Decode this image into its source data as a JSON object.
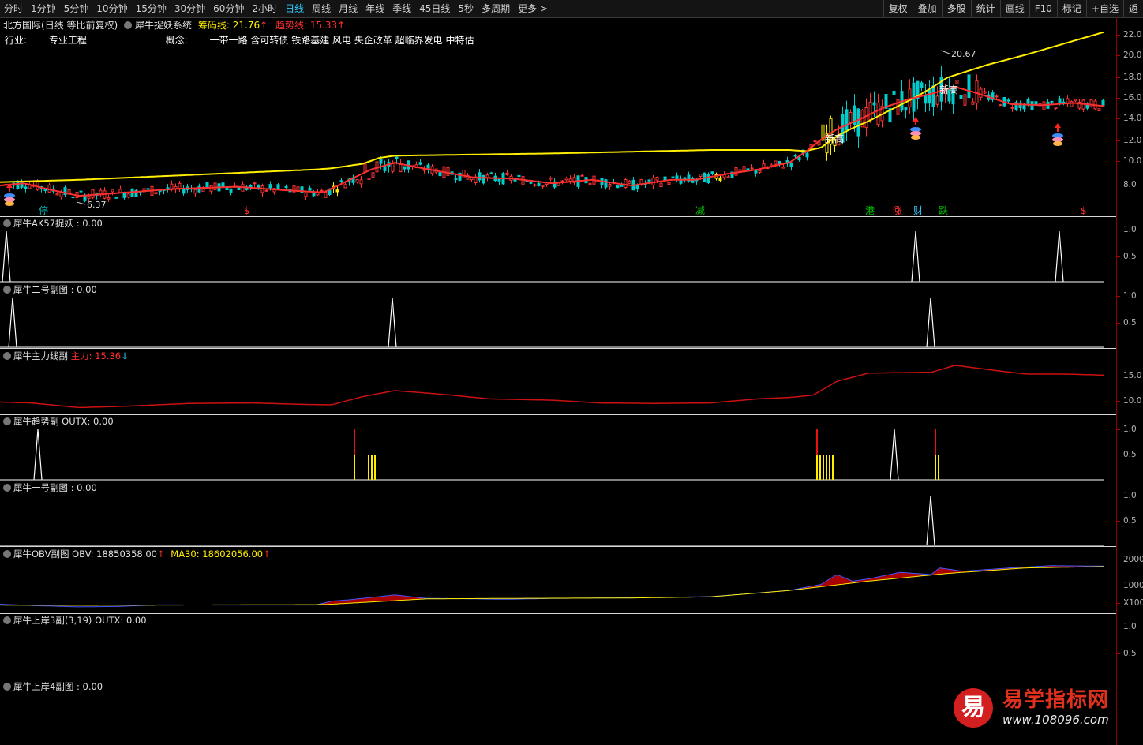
{
  "toolbar": {
    "periods": [
      "分时",
      "1分钟",
      "5分钟",
      "10分钟",
      "15分钟",
      "30分钟",
      "60分钟",
      "2小时",
      "日线",
      "周线",
      "月线",
      "年线",
      "季线",
      "45日线",
      "5秒",
      "多周期",
      "更多 >"
    ],
    "active_index": 8,
    "tools": [
      "复权",
      "叠加",
      "多股",
      "统计",
      "画线",
      "F10",
      "标记",
      "+自选",
      "返"
    ]
  },
  "stock": {
    "name": "北方国际",
    "mode": "(日线 等比前复权)",
    "system": "犀牛捉妖系统",
    "chip_label": "筹码线: 21.76",
    "trend_label": "趋势线: 15.33",
    "up_arrow": "↑",
    "down_arrow": "↓"
  },
  "meta": {
    "industry_label": "行业:",
    "industry": "专业工程",
    "concept_label": "概念:",
    "concepts": "一带一路 含可转债 铁路基建 风电 央企改革 超临界发电 中特估"
  },
  "main_chart": {
    "annotations": {
      "low": "6.37",
      "high": "20.67",
      "new_high": "新高"
    },
    "event_labels": [
      "停",
      "$",
      "减",
      "港",
      "涨",
      "财",
      "跌",
      "$"
    ],
    "yticks": [
      "22.0",
      "20.0",
      "18.0",
      "16.0",
      "14.0",
      "12.0",
      "10.0",
      "8.0"
    ]
  },
  "panels": [
    {
      "title": "犀牛AK57捉妖",
      "value": ": 0.00",
      "yticks": [
        "1.0",
        "0.5"
      ]
    },
    {
      "title": "犀牛二号副图",
      "value": ": 0.00",
      "yticks": [
        "1.0",
        "0.5"
      ]
    },
    {
      "title": "犀牛主力线副",
      "value_label": "主力: 15.36",
      "yticks": [
        "15.0",
        "10.0"
      ]
    },
    {
      "title": "犀牛趋势副",
      "value": "OUTX: 0.00",
      "yticks": [
        "1.0",
        "0.5"
      ]
    },
    {
      "title": "犀牛一号副图",
      "value": ": 0.00",
      "yticks": [
        "1.0",
        "0.5"
      ]
    },
    {
      "title": "犀牛OBV副图",
      "obv": "OBV: 18850358.00",
      "ma30": "MA30: 18602056.00",
      "yticks": [
        "2000",
        "1000",
        "X1000"
      ]
    },
    {
      "title": "犀牛上岸3副(3,19)",
      "value": "OUTX: 0.00",
      "yticks": [
        "1.0",
        "0.5"
      ]
    },
    {
      "title": "犀牛上岸4副图",
      "value": ": 0.00",
      "yticks": []
    }
  ],
  "watermark": {
    "logo": "易",
    "title": "易学指标网",
    "url": "www.108096.com"
  },
  "colors": {
    "trend_line": "#ff3030",
    "chip_line": "#ffee00",
    "main_line": "#cc1111",
    "obv_fill": "#aa0000",
    "up": "#ff3333",
    "down": "#00cccc",
    "yellow": "#ffee00",
    "teal": "#0bb"
  },
  "chart_data": [
    {
      "type": "line",
      "title": "",
      "y_range": [
        6.0,
        22.5
      ],
      "series": [
        {
          "name": "筹码线",
          "x": [
            0,
            100,
            200,
            300,
            400,
            420,
            440,
            460,
            480,
            500,
            600,
            700,
            800,
            900,
            1000,
            1020,
            1040,
            1060,
            1080,
            1100,
            1120,
            1140,
            1160,
            1180,
            1200,
            1250,
            1300,
            1350,
            1398
          ],
          "values": [
            8.7,
            8.9,
            9.2,
            9.5,
            9.8,
            9.9,
            10.1,
            10.3,
            10.8,
            11.0,
            11.1,
            11.2,
            11.35,
            11.5,
            11.5,
            11.4,
            11.7,
            12.7,
            13.4,
            14.0,
            14.7,
            15.4,
            16.1,
            16.9,
            17.8,
            18.9,
            19.8,
            20.8,
            21.76
          ]
        },
        {
          "name": "趋势线",
          "x": [
            0,
            30,
            60,
            100,
            160,
            220,
            300,
            360,
            410,
            440,
            470,
            500,
            520,
            560,
            600,
            650,
            700,
            750,
            800,
            850,
            880,
            920,
            960,
            1000,
            1020,
            1040,
            1060,
            1090,
            1120,
            1150,
            1180,
            1210,
            1240,
            1280,
            1320,
            1360,
            1398
          ],
          "values": [
            8.4,
            8.6,
            8.1,
            7.5,
            7.8,
            8.1,
            8.3,
            8.0,
            7.8,
            8.8,
            9.8,
            10.4,
            10.1,
            9.6,
            9.1,
            9.0,
            8.6,
            8.9,
            8.4,
            8.9,
            8.9,
            9.4,
            9.8,
            10.4,
            11.3,
            12.4,
            13.3,
            14.2,
            15.2,
            15.9,
            16.4,
            17.0,
            16.4,
            15.5,
            15.4,
            15.6,
            15.33
          ]
        }
      ]
    },
    {
      "type": "line",
      "title": "",
      "y_range": [
        0,
        1.0
      ],
      "series": [
        {
          "name": "AK57",
          "x": [
            8,
            1160,
            1342
          ],
          "values": [
            1,
            1,
            1
          ]
        }
      ]
    },
    {
      "type": "line",
      "title": "",
      "y_range": [
        0,
        1.0
      ],
      "series": [
        {
          "name": "二号",
          "x": [
            16,
            497,
            1179
          ],
          "values": [
            1,
            1,
            1
          ]
        }
      ]
    },
    {
      "type": "line",
      "title": "",
      "y_range": [
        7.0,
        18.0
      ],
      "series": [
        {
          "name": "主力",
          "x": [
            0,
            40,
            100,
            160,
            240,
            320,
            380,
            420,
            460,
            500,
            560,
            620,
            700,
            760,
            830,
            900,
            960,
            1000,
            1030,
            1060,
            1100,
            1140,
            1180,
            1210,
            1260,
            1300,
            1350,
            1398
          ],
          "values": [
            9.5,
            9.3,
            8.3,
            8.6,
            9.2,
            9.3,
            9.0,
            8.9,
            10.7,
            12.0,
            11.2,
            10.2,
            9.9,
            9.3,
            9.2,
            9.3,
            10.2,
            10.5,
            11.0,
            14.0,
            15.8,
            15.9,
            16.0,
            17.5,
            16.4,
            15.6,
            15.6,
            15.36
          ]
        }
      ]
    },
    {
      "type": "bar",
      "title": "",
      "y_range": [
        0,
        1.0
      ],
      "series": [
        {
          "name": "OUTX",
          "x": [
            48,
            1133
          ],
          "values": [
            1,
            1
          ]
        }
      ]
    },
    {
      "type": "line",
      "title": "",
      "y_range": [
        0,
        1.0
      ],
      "series": [
        {
          "name": "一号",
          "x": [
            1179
          ],
          "values": [
            1
          ]
        }
      ]
    },
    {
      "type": "area",
      "title": "",
      "y_range": [
        0,
        2500
      ],
      "series": [
        {
          "name": "OBV",
          "x": [
            0,
            50,
            100,
            150,
            200,
            300,
            400,
            420,
            440,
            480,
            500,
            540,
            580,
            640,
            700,
            800,
            900,
            1000,
            1040,
            1060,
            1080,
            1100,
            1140,
            1180,
            1190,
            1220,
            1280,
            1330,
            1398
          ],
          "values": [
            160,
            90,
            40,
            60,
            130,
            120,
            120,
            300,
            350,
            500,
            580,
            420,
            410,
            380,
            420,
            450,
            500,
            780,
            1050,
            1500,
            1200,
            1300,
            1600,
            1500,
            1800,
            1650,
            1800,
            1900,
            1880
          ]
        },
        {
          "name": "MA30",
          "x": [
            0,
            100,
            200,
            300,
            400,
            420,
            480,
            540,
            640,
            800,
            900,
            1000,
            1100,
            1200,
            1300,
            1398
          ],
          "values": [
            120,
            110,
            120,
            130,
            140,
            160,
            280,
            400,
            420,
            440,
            490,
            780,
            1200,
            1550,
            1800,
            1860
          ]
        }
      ]
    }
  ]
}
